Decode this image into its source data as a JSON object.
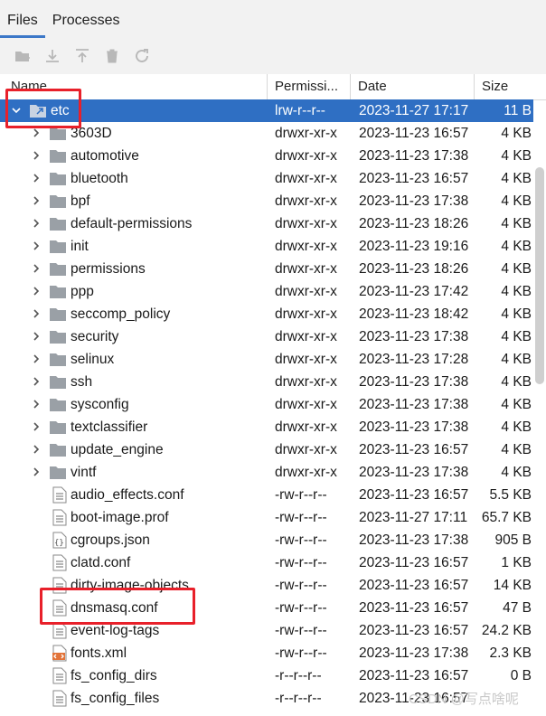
{
  "tabs": [
    {
      "label": "Files"
    },
    {
      "label": "Processes"
    }
  ],
  "columns": {
    "name": "Name",
    "permissions": "Permissi...",
    "date": "Date",
    "size": "Size"
  },
  "rows": [
    {
      "name": "etc",
      "perm": "lrw-r--r--",
      "date": "2023-11-27 17:17",
      "size": "11 B",
      "type": "link-folder",
      "expanded": true
    },
    {
      "name": "3603D",
      "perm": "drwxr-xr-x",
      "date": "2023-11-23 16:57",
      "size": "4 KB",
      "type": "folder"
    },
    {
      "name": "automotive",
      "perm": "drwxr-xr-x",
      "date": "2023-11-23 17:38",
      "size": "4 KB",
      "type": "folder"
    },
    {
      "name": "bluetooth",
      "perm": "drwxr-xr-x",
      "date": "2023-11-23 16:57",
      "size": "4 KB",
      "type": "folder"
    },
    {
      "name": "bpf",
      "perm": "drwxr-xr-x",
      "date": "2023-11-23 17:38",
      "size": "4 KB",
      "type": "folder"
    },
    {
      "name": "default-permissions",
      "perm": "drwxr-xr-x",
      "date": "2023-11-23 18:26",
      "size": "4 KB",
      "type": "folder"
    },
    {
      "name": "init",
      "perm": "drwxr-xr-x",
      "date": "2023-11-23 19:16",
      "size": "4 KB",
      "type": "folder"
    },
    {
      "name": "permissions",
      "perm": "drwxr-xr-x",
      "date": "2023-11-23 18:26",
      "size": "4 KB",
      "type": "folder"
    },
    {
      "name": "ppp",
      "perm": "drwxr-xr-x",
      "date": "2023-11-23 17:42",
      "size": "4 KB",
      "type": "folder"
    },
    {
      "name": "seccomp_policy",
      "perm": "drwxr-xr-x",
      "date": "2023-11-23 18:42",
      "size": "4 KB",
      "type": "folder"
    },
    {
      "name": "security",
      "perm": "drwxr-xr-x",
      "date": "2023-11-23 17:38",
      "size": "4 KB",
      "type": "folder"
    },
    {
      "name": "selinux",
      "perm": "drwxr-xr-x",
      "date": "2023-11-23 17:28",
      "size": "4 KB",
      "type": "folder"
    },
    {
      "name": "ssh",
      "perm": "drwxr-xr-x",
      "date": "2023-11-23 17:38",
      "size": "4 KB",
      "type": "folder"
    },
    {
      "name": "sysconfig",
      "perm": "drwxr-xr-x",
      "date": "2023-11-23 17:38",
      "size": "4 KB",
      "type": "folder"
    },
    {
      "name": "textclassifier",
      "perm": "drwxr-xr-x",
      "date": "2023-11-23 17:38",
      "size": "4 KB",
      "type": "folder"
    },
    {
      "name": "update_engine",
      "perm": "drwxr-xr-x",
      "date": "2023-11-23 16:57",
      "size": "4 KB",
      "type": "folder"
    },
    {
      "name": "vintf",
      "perm": "drwxr-xr-x",
      "date": "2023-11-23 17:38",
      "size": "4 KB",
      "type": "folder"
    },
    {
      "name": "audio_effects.conf",
      "perm": "-rw-r--r--",
      "date": "2023-11-23 16:57",
      "size": "5.5 KB",
      "type": "file"
    },
    {
      "name": "boot-image.prof",
      "perm": "-rw-r--r--",
      "date": "2023-11-27 17:11",
      "size": "65.7 KB",
      "type": "file"
    },
    {
      "name": "cgroups.json",
      "perm": "-rw-r--r--",
      "date": "2023-11-23 17:38",
      "size": "905 B",
      "type": "json"
    },
    {
      "name": "clatd.conf",
      "perm": "-rw-r--r--",
      "date": "2023-11-23 16:57",
      "size": "1 KB",
      "type": "file"
    },
    {
      "name": "dirty-image-objects",
      "perm": "-rw-r--r--",
      "date": "2023-11-23 16:57",
      "size": "14 KB",
      "type": "file"
    },
    {
      "name": "dnsmasq.conf",
      "perm": "-rw-r--r--",
      "date": "2023-11-23 16:57",
      "size": "47 B",
      "type": "file"
    },
    {
      "name": "event-log-tags",
      "perm": "-rw-r--r--",
      "date": "2023-11-23 16:57",
      "size": "24.2 KB",
      "type": "file"
    },
    {
      "name": "fonts.xml",
      "perm": "-rw-r--r--",
      "date": "2023-11-23 17:38",
      "size": "2.3 KB",
      "type": "xml"
    },
    {
      "name": "fs_config_dirs",
      "perm": "-r--r--r--",
      "date": "2023-11-23 16:57",
      "size": "0 B",
      "type": "file"
    },
    {
      "name": "fs_config_files",
      "perm": "-r--r--r--",
      "date": "2023-11-23 16:57",
      "size": "",
      "type": "file"
    }
  ],
  "watermark": "CSDN @写点啥呢",
  "colors": {
    "selection": "#2f6fc3",
    "highlight_box": "#e8202a",
    "tab_underline": "#3c78c8"
  }
}
